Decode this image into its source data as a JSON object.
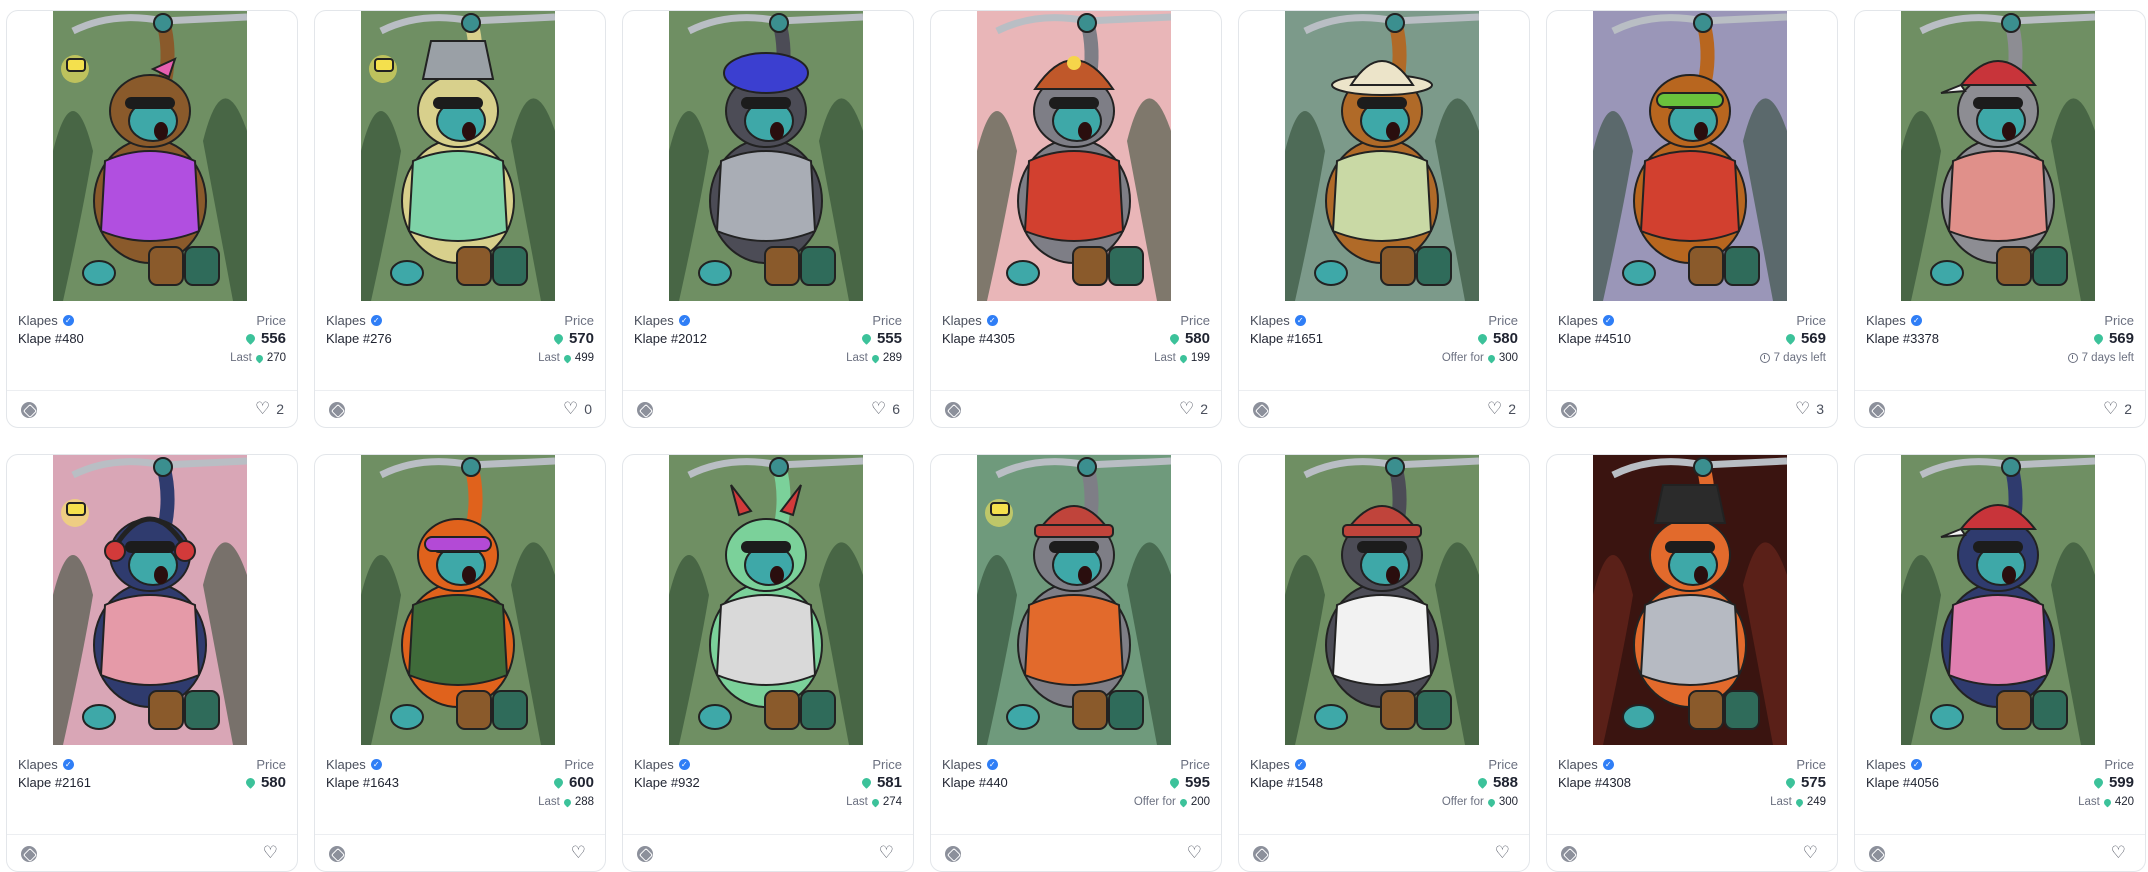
{
  "labels": {
    "price": "Price"
  },
  "cards": [
    {
      "collection": "Klapes",
      "name": "Klape #480",
      "price": "556",
      "sub_type": "last",
      "sub_label": "Last",
      "sub_value": "270",
      "likes": "2",
      "bg": "#6f8f63",
      "fur": "#8a5a2b",
      "shirt": "#b14fe0",
      "hat": "none",
      "hat_color": "#e75fb0",
      "lamp": true
    },
    {
      "collection": "Klapes",
      "name": "Klape #276",
      "price": "570",
      "sub_type": "last",
      "sub_label": "Last",
      "sub_value": "499",
      "likes": "0",
      "bg": "#6f8f63",
      "fur": "#d8d08c",
      "shirt": "#7fd3a8",
      "hat": "bucket",
      "hat_color": "#9aa0a6",
      "lamp": true
    },
    {
      "collection": "Klapes",
      "name": "Klape #2012",
      "price": "555",
      "sub_type": "last",
      "sub_label": "Last",
      "sub_value": "289",
      "likes": "6",
      "bg": "#6f8f63",
      "fur": "#4c4c56",
      "shirt": "#a9adb5",
      "hat": "beret",
      "hat_color": "#3b3fd0",
      "lamp": false
    },
    {
      "collection": "Klapes",
      "name": "Klape #4305",
      "price": "580",
      "sub_type": "last",
      "sub_label": "Last",
      "sub_value": "199",
      "likes": "2",
      "bg": "#e9b6b8",
      "fur": "#7e7e86",
      "shirt": "#d2402f",
      "hat": "helmet",
      "hat_color": "#c0582a",
      "lamp": false
    },
    {
      "collection": "Klapes",
      "name": "Klape #1651",
      "price": "580",
      "sub_type": "offer",
      "sub_label": "Offer for",
      "sub_value": "300",
      "likes": "2",
      "bg": "#7c9a8a",
      "fur": "#b06a28",
      "shirt": "#c9d9a5",
      "hat": "safari",
      "hat_color": "#ece4c9",
      "lamp": false
    },
    {
      "collection": "Klapes",
      "name": "Klape #4510",
      "price": "569",
      "sub_type": "time",
      "sub_label": "7 days left",
      "sub_value": "",
      "likes": "3",
      "bg": "#9a96b8",
      "fur": "#b8661f",
      "shirt": "#d2402f",
      "hat": "goggles",
      "hat_color": "#6ac23c",
      "lamp": false
    },
    {
      "collection": "Klapes",
      "name": "Klape #3378",
      "price": "569",
      "sub_type": "time",
      "sub_label": "7 days left",
      "sub_value": "",
      "likes": "2",
      "bg": "#6f8f63",
      "fur": "#8d8d93",
      "shirt": "#e0908a",
      "hat": "cap",
      "hat_color": "#c8343a",
      "lamp": false
    },
    {
      "collection": "Klapes",
      "name": "Klape #2161",
      "price": "580",
      "sub_type": "none",
      "sub_label": "",
      "sub_value": "",
      "likes": "",
      "bg": "#d9a6b6",
      "fur": "#2f3b6e",
      "shirt": "#e59aa8",
      "hat": "headphones",
      "hat_color": "#d23a3a",
      "lamp": true
    },
    {
      "collection": "Klapes",
      "name": "Klape #1643",
      "price": "600",
      "sub_type": "last",
      "sub_label": "Last",
      "sub_value": "288",
      "likes": "",
      "bg": "#6f8f63",
      "fur": "#e0621c",
      "shirt": "#3f6b3a",
      "hat": "goggles",
      "hat_color": "#b34ad6",
      "lamp": false
    },
    {
      "collection": "Klapes",
      "name": "Klape #932",
      "price": "581",
      "sub_type": "last",
      "sub_label": "Last",
      "sub_value": "274",
      "likes": "",
      "bg": "#6f8f63",
      "fur": "#7bd19a",
      "shirt": "#d9d9d9",
      "hat": "horns",
      "hat_color": "#d23a3a",
      "lamp": false
    },
    {
      "collection": "Klapes",
      "name": "Klape #440",
      "price": "595",
      "sub_type": "offer",
      "sub_label": "Offer for",
      "sub_value": "200",
      "likes": "",
      "bg": "#6f9a7c",
      "fur": "#7e7e86",
      "shirt": "#e26a2c",
      "hat": "beanie",
      "hat_color": "#c0443b",
      "lamp": true
    },
    {
      "collection": "Klapes",
      "name": "Klape #1548",
      "price": "588",
      "sub_type": "offer",
      "sub_label": "Offer for",
      "sub_value": "300",
      "likes": "",
      "bg": "#6f8f63",
      "fur": "#4c4c56",
      "shirt": "#f2f2f2",
      "hat": "beanie",
      "hat_color": "#c0443b",
      "lamp": false
    },
    {
      "collection": "Klapes",
      "name": "Klape #4308",
      "price": "575",
      "sub_type": "last",
      "sub_label": "Last",
      "sub_value": "249",
      "likes": "",
      "bg": "#3a1410",
      "fur": "#e26a2c",
      "shirt": "#b6bac2",
      "hat": "bucket",
      "hat_color": "#2b2b2b",
      "lamp": false
    },
    {
      "collection": "Klapes",
      "name": "Klape #4056",
      "price": "599",
      "sub_type": "last",
      "sub_label": "Last",
      "sub_value": "420",
      "likes": "",
      "bg": "#6f8f63",
      "fur": "#2f3b6e",
      "shirt": "#e07fb0",
      "hat": "cap",
      "hat_color": "#c8343a",
      "lamp": false
    }
  ]
}
